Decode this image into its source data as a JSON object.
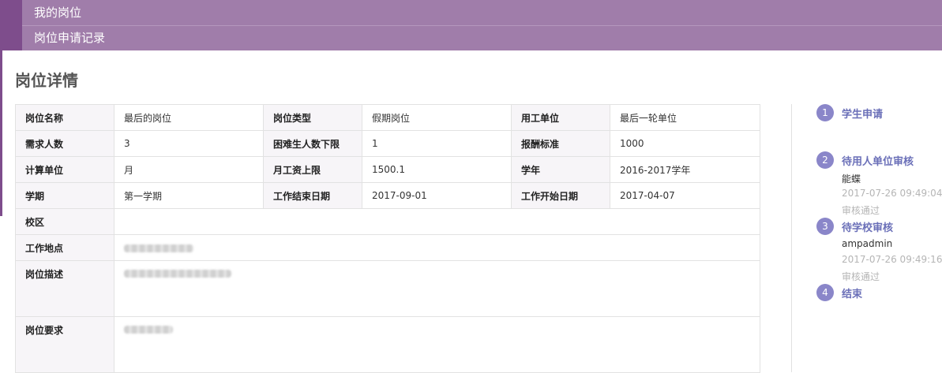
{
  "nav": {
    "items": [
      "我的岗位",
      "岗位申请记录"
    ]
  },
  "page": {
    "title": "岗位详情"
  },
  "detail": {
    "rows": [
      [
        {
          "label": "岗位名称",
          "value": "最后的岗位"
        },
        {
          "label": "岗位类型",
          "value": "假期岗位"
        },
        {
          "label": "用工单位",
          "value": "最后一轮单位"
        }
      ],
      [
        {
          "label": "需求人数",
          "value": "3"
        },
        {
          "label": "困难生人数下限",
          "value": "1"
        },
        {
          "label": "报酬标准",
          "value": "1000"
        }
      ],
      [
        {
          "label": "计算单位",
          "value": "月"
        },
        {
          "label": "月工资上限",
          "value": "1500.1"
        },
        {
          "label": "学年",
          "value": "2016-2017学年"
        }
      ],
      [
        {
          "label": "学期",
          "value": "第一学期"
        },
        {
          "label": "工作结束日期",
          "value": "2017-09-01"
        },
        {
          "label": "工作开始日期",
          "value": "2017-04-07"
        }
      ]
    ],
    "campus_label": "校区",
    "location_label": "工作地点",
    "description_label": "岗位描述",
    "requirement_label": "岗位要求"
  },
  "workflow": {
    "steps": [
      {
        "num": "1",
        "title": "学生申请"
      },
      {
        "num": "2",
        "title": "待用人单位审核",
        "who": "能蝶",
        "time": "2017-07-26 09:49:04",
        "status": "审核通过"
      },
      {
        "num": "3",
        "title": "待学校审核",
        "who": "ampadmin",
        "time": "2017-07-26 09:49:16",
        "status": "审核通过"
      },
      {
        "num": "4",
        "title": "结束"
      }
    ]
  },
  "colors": {
    "nav_bg": "#a07daa",
    "nav_accent": "#7e4d8c",
    "step_circle": "#8a86c9",
    "step_title": "#6a6fb8"
  }
}
